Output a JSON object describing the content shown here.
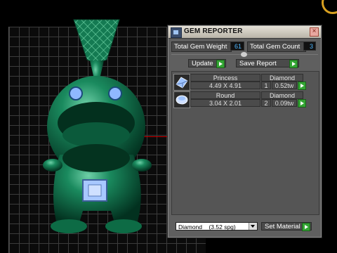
{
  "window": {
    "title": "GEM REPORTER"
  },
  "totals": {
    "weight_label": "Total Gem Weight",
    "weight_value": "61",
    "count_label": "Total Gem Count",
    "count_value": "3"
  },
  "actions": {
    "update_label": "Update",
    "save_label": "Save Report"
  },
  "gems": [
    {
      "cut": "Princess",
      "material": "Diamond",
      "size": "4.49 X 4.91",
      "qty": "1",
      "weight": "0.52tw",
      "icon": "princess-gem-icon"
    },
    {
      "cut": "Round",
      "material": "Diamond",
      "size": "3.04 X 2.01",
      "qty": "2",
      "weight": "0.09tw",
      "icon": "round-gem-icon"
    }
  ],
  "material_select": {
    "selected": "Diamond    (3.52 spg)"
  },
  "set_material_label": "Set Material",
  "colors": {
    "model": "#0f6b4a",
    "accent_value": "#4fb7ff",
    "play_button": "#33a533"
  }
}
